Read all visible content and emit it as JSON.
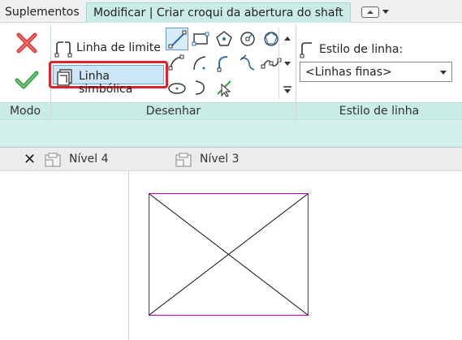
{
  "ribbon_tabs": {
    "suplementos": "Suplementos",
    "modificar": "Modificar | Criar croqui da abertura do shaft"
  },
  "quick_access": {
    "button_icon": "window-toggle-icon",
    "dropdown_icon": "chevron-down-icon"
  },
  "panels": {
    "modo": {
      "title": "Modo",
      "cancel_icon": "cancel-x-icon",
      "finish_icon": "finish-check-icon"
    },
    "desenhar": {
      "title": "Desenhar",
      "linha_limite": "Linha de limite",
      "linha_simbolica": "Linha simbólica"
    },
    "estilo": {
      "title": "Estilo de linha",
      "label": "Estilo de linha:",
      "selected": "<Linhas finas>"
    }
  },
  "view_tabs": [
    {
      "label": "Nível 4"
    },
    {
      "label": "Nível 3"
    }
  ],
  "colors": {
    "ribbon_accent": "#c9ece6",
    "selection_border": "#e0202a",
    "shaft_outline": "#c000c0",
    "cancel_red": "#e03a3a",
    "finish_green": "#3aa04a"
  }
}
